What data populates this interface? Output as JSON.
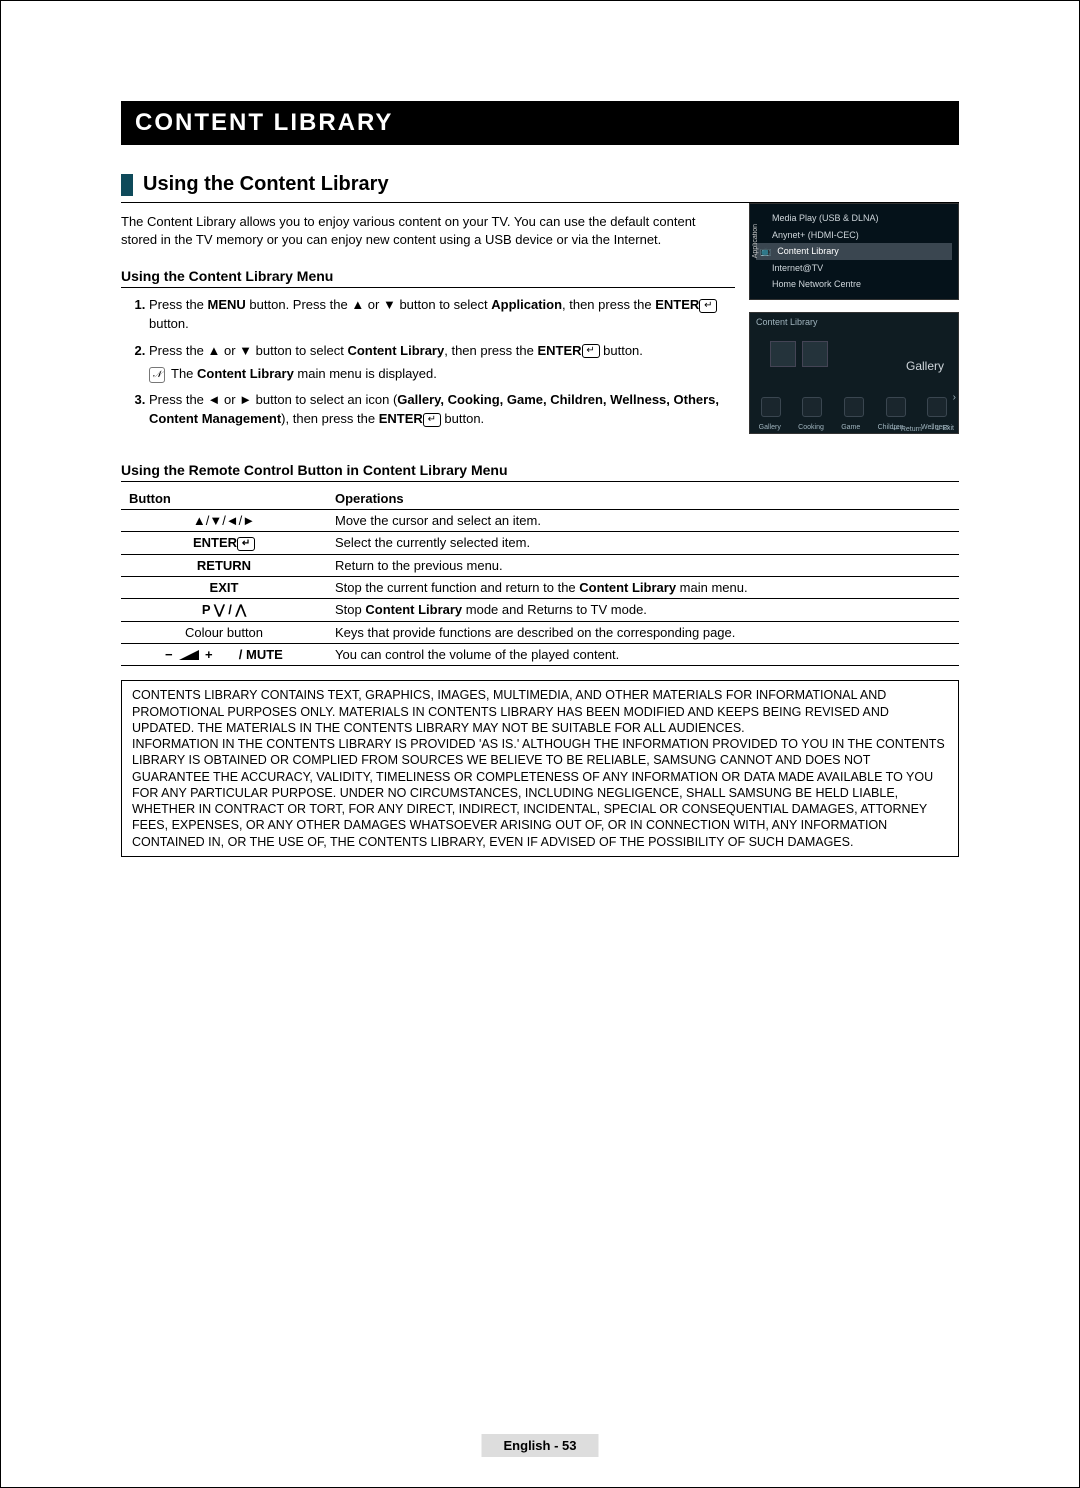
{
  "chapter": "CONTENT LIBRARY",
  "section_title": "Using the Content Library",
  "intro": "The Content Library allows you to enjoy various content on your TV. You can use the default content stored in the TV memory or you can enjoy new content using a USB device or via the Internet.",
  "subhead_menu": "Using the Content Library Menu",
  "steps": {
    "1_pre": "Press the ",
    "1_b1": "MENU",
    "1_mid1": " button. Press the ▲ or ▼ button to select ",
    "1_b2": "Application",
    "1_mid2": ", then press the ",
    "1_b3": "ENTER",
    "1_post": " button.",
    "2_pre": "Press the ▲ or ▼ button to select ",
    "2_b1": "Content Library",
    "2_mid": ", then press the ",
    "2_b2": "ENTER",
    "2_post": " button.",
    "2_note_pre": "The ",
    "2_note_b": "Content Library",
    "2_note_post": " main menu is displayed.",
    "3_pre": "Press the ◄ or ► button to select an icon (",
    "3_b1": "Gallery, Cooking, Game, Children, Wellness, Others, Content Management",
    "3_mid": "), then press the ",
    "3_b2": "ENTER",
    "3_post": " button."
  },
  "subhead_remote": "Using the Remote Control Button in Content Library Menu",
  "table": {
    "header_btn": "Button",
    "header_ops": "Operations",
    "rows": [
      {
        "btn": "▲/▼/◄/►",
        "bold": false,
        "op": "Move the cursor and select an item."
      },
      {
        "btn": "ENTER",
        "enter_icon": true,
        "bold": true,
        "op": "Select the currently selected item."
      },
      {
        "btn": "RETURN",
        "bold": true,
        "op": "Return to the previous menu."
      },
      {
        "btn": "EXIT",
        "bold": true,
        "op_pre": "Stop the current function and return to the ",
        "op_b": "Content Library",
        "op_post": " main menu."
      },
      {
        "btn": "P ⋁ / ⋀",
        "bold": true,
        "op_pre": "Stop ",
        "op_b": "Content Library",
        "op_post": " mode and Returns to TV mode."
      },
      {
        "btn": "Colour button",
        "bold": false,
        "op": "Keys that provide functions are described on the corresponding page."
      },
      {
        "btn_html": "vol_mute",
        "bold": false,
        "op": "You can control the volume of the played content."
      }
    ],
    "volmute_label": " / MUTE"
  },
  "disclaimer_p1": "CONTENTS LIBRARY CONTAINS TEXT, GRAPHICS, IMAGES, MULTIMEDIA, AND OTHER MATERIALS FOR INFORMATIONAL AND PROMOTIONAL PURPOSES ONLY. MATERIALS IN CONTENTS LIBRARY HAS BEEN MODIFIED AND KEEPS BEING REVISED AND UPDATED. THE MATERIALS IN THE CONTENTS LIBRARY MAY NOT BE SUITABLE FOR ALL AUDIENCES.",
  "disclaimer_p2": "INFORMATION IN THE CONTENTS LIBRARY IS PROVIDED 'AS IS.' ALTHOUGH THE INFORMATION PROVIDED TO YOU IN THE CONTENTS LIBRARY IS OBTAINED OR COMPLIED FROM SOURCES WE BELIEVE TO BE RELIABLE, SAMSUNG CANNOT AND DOES NOT GUARANTEE THE ACCURACY, VALIDITY, TIMELINESS OR COMPLETENESS OF ANY INFORMATION OR DATA MADE AVAILABLE TO YOU FOR ANY PARTICULAR PURPOSE. UNDER NO CIRCUMSTANCES, INCLUDING NEGLIGENCE, SHALL SAMSUNG BE HELD LIABLE, WHETHER IN CONTRACT OR TORT, FOR ANY DIRECT, INDIRECT, INCIDENTAL, SPECIAL OR CONSEQUENTIAL DAMAGES, ATTORNEY FEES, EXPENSES, OR ANY OTHER DAMAGES WHATSOEVER ARISING OUT OF, OR IN CONNECTION WITH, ANY INFORMATION CONTAINED IN, OR THE USE OF, THE CONTENTS LIBRARY, EVEN IF ADVISED OF THE POSSIBILITY OF SUCH DAMAGES.",
  "osd1": {
    "vert": "Application",
    "l1": "Media Play (USB & DLNA)",
    "l2": "Anynet+ (HDMI-CEC)",
    "l3": "Content Library",
    "l4": "Internet@TV",
    "l5": "Home Network Centre"
  },
  "osd2": {
    "title": "Content Library",
    "center": "Gallery",
    "strip": [
      "Gallery",
      "Cooking",
      "Game",
      "Children",
      "Wellness"
    ],
    "return": "↩ Return",
    "exit": "→⎐ Exit"
  },
  "footer_lang": "English - ",
  "footer_page": "53"
}
